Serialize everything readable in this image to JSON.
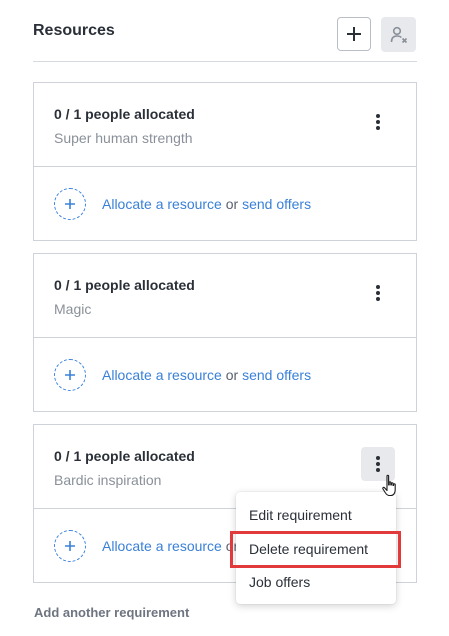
{
  "header": {
    "title": "Resources",
    "add_icon": "plus-icon",
    "unassign_icon": "person-remove-icon"
  },
  "requirements": [
    {
      "allocation": "0 / 1 people allocated",
      "name": "Super human strength"
    },
    {
      "allocation": "0 / 1 people allocated",
      "name": "Magic"
    },
    {
      "allocation": "0 / 1 people allocated",
      "name": "Bardic inspiration"
    }
  ],
  "allocate": {
    "allocate_label": "Allocate a resource",
    "or_label": "or",
    "offers_label": "send offers"
  },
  "footer": {
    "add_another": "Add another requirement"
  },
  "context_menu": {
    "items": [
      "Edit requirement",
      "Delete requirement",
      "Job offers"
    ],
    "highlighted_item": "Delete requirement"
  },
  "colors": {
    "accent": "#3a80d8",
    "highlight": "#e23a3a",
    "text": "#2b3038",
    "muted": "#8a9099"
  }
}
